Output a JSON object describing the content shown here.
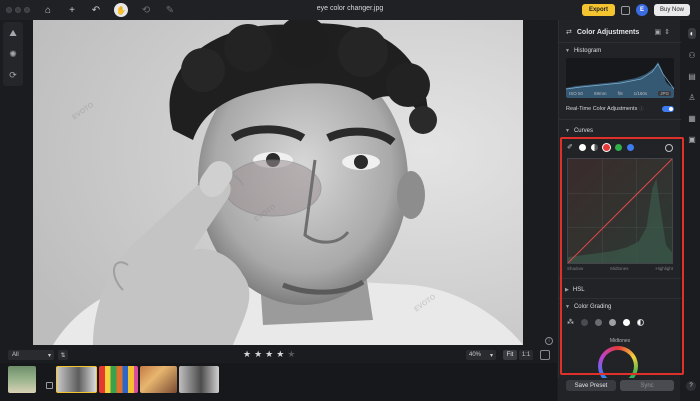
{
  "titlebar": {
    "doc_title": "eye color changer.jpg",
    "export_label": "Export",
    "avatar_letter": "E",
    "buynow_label": "Buy Now"
  },
  "panel": {
    "title": "Color Adjustments",
    "histogram_label": "Histogram",
    "hist_iso": "ISO 50",
    "hist_focal": "59mm",
    "hist_aperture": "f/8",
    "hist_shutter": "1/160s",
    "hist_format": "JPG",
    "realtime_label": "Real-Time Color Adjustments",
    "curves_label": "Curves",
    "curve_shadow": "Shadow",
    "curve_midtones": "Midtones",
    "curve_highlight": "Highlight",
    "hsl_label": "HSL",
    "color_grading_label": "Color Grading",
    "midtones_label": "Midtones",
    "save_preset_label": "Save Preset",
    "sync_label": "Sync"
  },
  "bottom": {
    "filter_value": "All",
    "zoom_value": "40%",
    "fit_label": "Fit",
    "one_label": "1:1",
    "rating": 4,
    "rating_max": 5
  },
  "watermark": "EVOTO",
  "colors": {
    "accent": "#f4c430",
    "highlight_frame": "#e0302a",
    "toggle": "#3d7bf0"
  }
}
